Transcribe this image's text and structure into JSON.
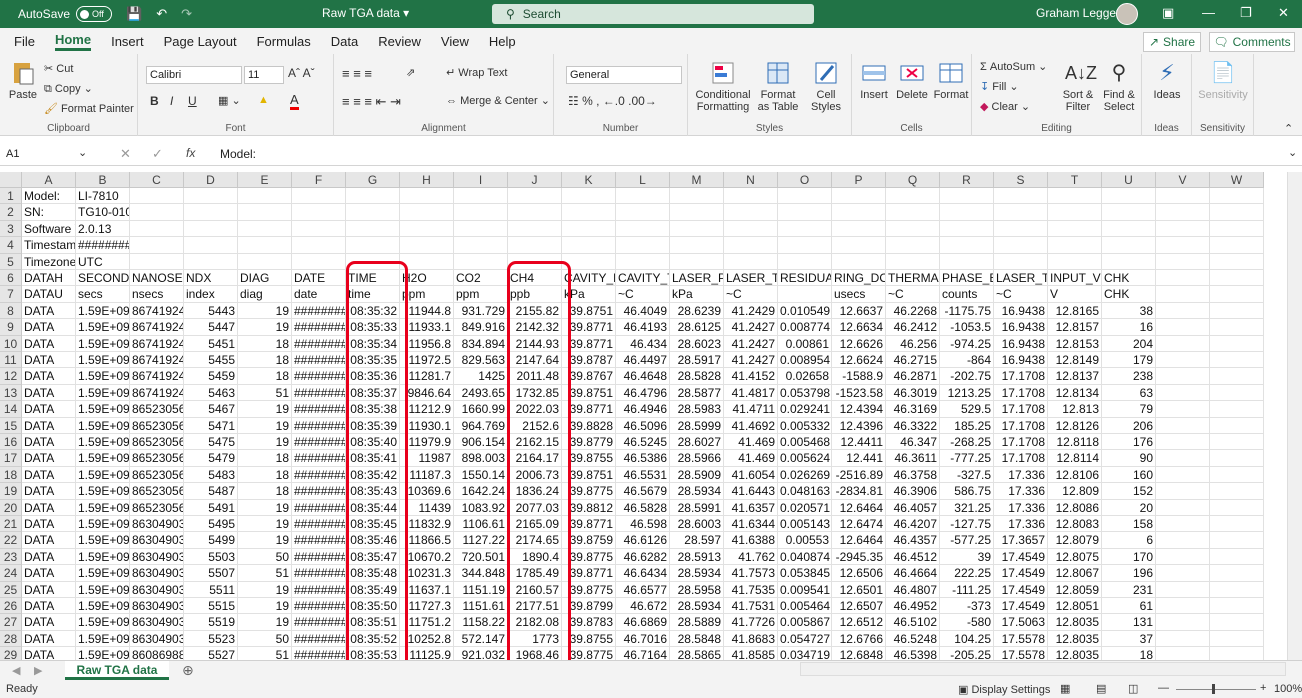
{
  "titlebar": {
    "autosave_label": "AutoSave",
    "autosave_state": "Off",
    "doc_title": "Raw TGA data",
    "search_placeholder": "Search",
    "user_name": "Graham Leggett"
  },
  "menu": {
    "tabs": [
      "File",
      "Home",
      "Insert",
      "Page Layout",
      "Formulas",
      "Data",
      "Review",
      "View",
      "Help"
    ],
    "active": "Home",
    "share": "Share",
    "comments": "Comments"
  },
  "ribbon": {
    "clipboard": {
      "paste": "Paste",
      "cut": "Cut",
      "copy": "Copy",
      "format_painter": "Format Painter",
      "label": "Clipboard"
    },
    "font": {
      "name": "Calibri",
      "size": "11",
      "label": "Font"
    },
    "alignment": {
      "wrap": "Wrap Text",
      "merge": "Merge & Center",
      "label": "Alignment"
    },
    "number": {
      "format": "General",
      "label": "Number"
    },
    "styles": {
      "conditional": "Conditional Formatting",
      "format_table": "Format as Table",
      "cell_styles": "Cell Styles",
      "label": "Styles"
    },
    "cells": {
      "insert": "Insert",
      "delete": "Delete",
      "format": "Format",
      "label": "Cells"
    },
    "editing": {
      "autosum": "AutoSum",
      "fill": "Fill",
      "clear": "Clear",
      "sort": "Sort & Filter",
      "find": "Find & Select",
      "label": "Editing"
    },
    "ideas": {
      "ideas": "Ideas",
      "label": "Ideas"
    },
    "sensitivity": {
      "sensitivity": "Sensitivity",
      "label": "Sensitivity"
    }
  },
  "formula_bar": {
    "name_box": "A1",
    "fx": "fx",
    "formula": "Model:"
  },
  "columns": [
    "A",
    "B",
    "C",
    "D",
    "E",
    "F",
    "G",
    "H",
    "I",
    "J",
    "K",
    "L",
    "M",
    "N",
    "O",
    "P",
    "Q",
    "R",
    "S",
    "T",
    "U",
    "V",
    "W"
  ],
  "rows": [
    [
      "Model:",
      "LI-7810",
      "",
      "",
      "",
      "",
      "",
      "",
      "",
      "",
      "",
      "",
      "",
      "",
      "",
      "",
      "",
      "",
      "",
      "",
      ""
    ],
    [
      "SN:",
      "TG10-01042",
      "",
      "",
      "",
      "",
      "",
      "",
      "",
      "",
      "",
      "",
      "",
      "",
      "",
      "",
      "",
      "",
      "",
      "",
      ""
    ],
    [
      "Software V",
      "2.0.13",
      "",
      "",
      "",
      "",
      "",
      "",
      "",
      "",
      "",
      "",
      "",
      "",
      "",
      "",
      "",
      "",
      "",
      "",
      ""
    ],
    [
      "Timestamp",
      "########",
      "",
      "",
      "",
      "",
      "",
      "",
      "",
      "",
      "",
      "",
      "",
      "",
      "",
      "",
      "",
      "",
      "",
      "",
      ""
    ],
    [
      "Timezone:",
      "UTC",
      "",
      "",
      "",
      "",
      "",
      "",
      "",
      "",
      "",
      "",
      "",
      "",
      "",
      "",
      "",
      "",
      "",
      "",
      ""
    ],
    [
      "DATAH",
      "SECONDS",
      "NANOSECO",
      "NDX",
      "DIAG",
      "DATE",
      "TIME",
      "H2O",
      "CO2",
      "CH4",
      "CAVITY_P",
      "CAVITY_T",
      "LASER_PHA",
      "LASER_T",
      "RESIDUAL",
      "RING_DOW",
      "THERMAL_",
      "PHASE_ER",
      "LASER_T_S",
      "INPUT_VO",
      "CHK"
    ],
    [
      "DATAU",
      "secs",
      "nsecs",
      "index",
      "diag",
      "date",
      "time",
      "ppm",
      "ppm",
      "ppb",
      "kPa",
      "~C",
      "kPa",
      "~C",
      "",
      "usecs",
      "~C",
      "counts",
      "~C",
      "V",
      "CHK"
    ],
    [
      "DATA",
      "1.59E+09",
      "86741924",
      "5443",
      "19",
      "########",
      "08:35:32",
      "11944.8",
      "931.729",
      "2155.82",
      "39.8751",
      "46.4049",
      "28.6239",
      "41.2429",
      "0.010549",
      "12.6637",
      "46.2268",
      "-1175.75",
      "16.9438",
      "12.8165",
      "38"
    ],
    [
      "DATA",
      "1.59E+09",
      "86741924",
      "5447",
      "19",
      "########",
      "08:35:33",
      "11933.1",
      "849.916",
      "2142.32",
      "39.8771",
      "46.4193",
      "28.6125",
      "41.2427",
      "0.008774",
      "12.6634",
      "46.2412",
      "-1053.5",
      "16.9438",
      "12.8157",
      "16"
    ],
    [
      "DATA",
      "1.59E+09",
      "86741924",
      "5451",
      "18",
      "########",
      "08:35:34",
      "11956.8",
      "834.894",
      "2144.93",
      "39.8771",
      "46.434",
      "28.6023",
      "41.2427",
      "0.00861",
      "12.6626",
      "46.256",
      "-974.25",
      "16.9438",
      "12.8153",
      "204"
    ],
    [
      "DATA",
      "1.59E+09",
      "86741924",
      "5455",
      "18",
      "########",
      "08:35:35",
      "11972.5",
      "829.563",
      "2147.64",
      "39.8787",
      "46.4497",
      "28.5917",
      "41.2427",
      "0.008954",
      "12.6624",
      "46.2715",
      "-864",
      "16.9438",
      "12.8149",
      "179"
    ],
    [
      "DATA",
      "1.59E+09",
      "86741924",
      "5459",
      "18",
      "########",
      "08:35:36",
      "11281.7",
      "1425",
      "2011.48",
      "39.8767",
      "46.4648",
      "28.5828",
      "41.4152",
      "0.02658",
      "-1588.9",
      "46.2871",
      "-202.75",
      "17.1708",
      "12.8137",
      "238"
    ],
    [
      "DATA",
      "1.59E+09",
      "86741924",
      "5463",
      "51",
      "########",
      "08:35:37",
      "9846.64",
      "2493.65",
      "1732.85",
      "39.8751",
      "46.4796",
      "28.5877",
      "41.4817",
      "0.053798",
      "-1523.58",
      "46.3019",
      "1213.25",
      "17.1708",
      "12.8134",
      "63"
    ],
    [
      "DATA",
      "1.59E+09",
      "86523056",
      "5467",
      "19",
      "########",
      "08:35:38",
      "11212.9",
      "1660.99",
      "2022.03",
      "39.8771",
      "46.4946",
      "28.5983",
      "41.4711",
      "0.029241",
      "12.4394",
      "46.3169",
      "529.5",
      "17.1708",
      "12.813",
      "79"
    ],
    [
      "DATA",
      "1.59E+09",
      "86523056",
      "5471",
      "19",
      "########",
      "08:35:39",
      "11930.1",
      "964.769",
      "2152.6",
      "39.8828",
      "46.5096",
      "28.5999",
      "41.4692",
      "0.005332",
      "12.4396",
      "46.3322",
      "185.25",
      "17.1708",
      "12.8126",
      "206"
    ],
    [
      "DATA",
      "1.59E+09",
      "86523056",
      "5475",
      "19",
      "########",
      "08:35:40",
      "11979.9",
      "906.154",
      "2162.15",
      "39.8779",
      "46.5245",
      "28.6027",
      "41.469",
      "0.005468",
      "12.4411",
      "46.347",
      "-268.25",
      "17.1708",
      "12.8118",
      "176"
    ],
    [
      "DATA",
      "1.59E+09",
      "86523056",
      "5479",
      "18",
      "########",
      "08:35:41",
      "11987",
      "898.003",
      "2164.17",
      "39.8755",
      "46.5386",
      "28.5966",
      "41.469",
      "0.005624",
      "12.441",
      "46.3611",
      "-777.25",
      "17.1708",
      "12.8114",
      "90"
    ],
    [
      "DATA",
      "1.59E+09",
      "86523056",
      "5483",
      "18",
      "########",
      "08:35:42",
      "11187.3",
      "1550.14",
      "2006.73",
      "39.8751",
      "46.5531",
      "28.5909",
      "41.6054",
      "0.026269",
      "-2516.89",
      "46.3758",
      "-327.5",
      "17.336",
      "12.8106",
      "160"
    ],
    [
      "DATA",
      "1.59E+09",
      "86523056",
      "5487",
      "18",
      "########",
      "08:35:43",
      "10369.6",
      "1642.24",
      "1836.24",
      "39.8775",
      "46.5679",
      "28.5934",
      "41.6443",
      "0.048163",
      "-2834.81",
      "46.3906",
      "586.75",
      "17.336",
      "12.809",
      "152"
    ],
    [
      "DATA",
      "1.59E+09",
      "86523056",
      "5491",
      "19",
      "########",
      "08:35:44",
      "11439",
      "1083.92",
      "2077.03",
      "39.8812",
      "46.5828",
      "28.5991",
      "41.6357",
      "0.020571",
      "12.6464",
      "46.4057",
      "321.25",
      "17.336",
      "12.8086",
      "20"
    ],
    [
      "DATA",
      "1.59E+09",
      "86304903",
      "5495",
      "19",
      "########",
      "08:35:45",
      "11832.9",
      "1106.61",
      "2165.09",
      "39.8771",
      "46.598",
      "28.6003",
      "41.6344",
      "0.005143",
      "12.6474",
      "46.4207",
      "-127.75",
      "17.336",
      "12.8083",
      "158"
    ],
    [
      "DATA",
      "1.59E+09",
      "86304903",
      "5499",
      "19",
      "########",
      "08:35:46",
      "11866.5",
      "1127.22",
      "2174.65",
      "39.8759",
      "46.6126",
      "28.597",
      "41.6388",
      "0.00553",
      "12.6464",
      "46.4357",
      "-577.25",
      "17.3657",
      "12.8079",
      "6"
    ],
    [
      "DATA",
      "1.59E+09",
      "86304903",
      "5503",
      "50",
      "########",
      "08:35:47",
      "10670.2",
      "720.501",
      "1890.4",
      "39.8775",
      "46.6282",
      "28.5913",
      "41.762",
      "0.040874",
      "-2945.35",
      "46.4512",
      "39",
      "17.4549",
      "12.8075",
      "170"
    ],
    [
      "DATA",
      "1.59E+09",
      "86304903",
      "5507",
      "51",
      "########",
      "08:35:48",
      "10231.3",
      "344.848",
      "1785.49",
      "39.8771",
      "46.6434",
      "28.5934",
      "41.7573",
      "0.053845",
      "12.6506",
      "46.4664",
      "222.25",
      "17.4549",
      "12.8067",
      "196"
    ],
    [
      "DATA",
      "1.59E+09",
      "86304903",
      "5511",
      "19",
      "########",
      "08:35:49",
      "11637.1",
      "1151.19",
      "2160.57",
      "39.8775",
      "46.6577",
      "28.5958",
      "41.7535",
      "0.009541",
      "12.6501",
      "46.4807",
      "-111.25",
      "17.4549",
      "12.8059",
      "231"
    ],
    [
      "DATA",
      "1.59E+09",
      "86304903",
      "5515",
      "19",
      "########",
      "08:35:50",
      "11727.3",
      "1151.61",
      "2177.51",
      "39.8799",
      "46.672",
      "28.5934",
      "41.7531",
      "0.005464",
      "12.6507",
      "46.4952",
      "-373",
      "17.4549",
      "12.8051",
      "61"
    ],
    [
      "DATA",
      "1.59E+09",
      "86304903",
      "5519",
      "19",
      "########",
      "08:35:51",
      "11751.2",
      "1158.22",
      "2182.08",
      "39.8783",
      "46.6869",
      "28.5889",
      "41.7726",
      "0.005867",
      "12.6512",
      "46.5102",
      "-580",
      "17.5063",
      "12.8035",
      "131"
    ],
    [
      "DATA",
      "1.59E+09",
      "86304903",
      "5523",
      "50",
      "########",
      "08:35:52",
      "10252.8",
      "572.147",
      "1773",
      "39.8755",
      "46.7016",
      "28.5848",
      "41.8683",
      "0.054727",
      "12.6766",
      "46.5248",
      "104.25",
      "17.5578",
      "12.8035",
      "37"
    ],
    [
      "DATA",
      "1.59E+09",
      "86086988",
      "5527",
      "51",
      "########",
      "08:35:53",
      "11125.9",
      "921.032",
      "1968.46",
      "39.8775",
      "46.7164",
      "28.5865",
      "41.8585",
      "0.034719",
      "12.6848",
      "46.5398",
      "-205.25",
      "17.5578",
      "12.8035",
      "18"
    ]
  ],
  "sheet_tab": "Raw TGA data",
  "status": {
    "ready": "Ready",
    "display_settings": "Display Settings",
    "zoom": "100%"
  }
}
